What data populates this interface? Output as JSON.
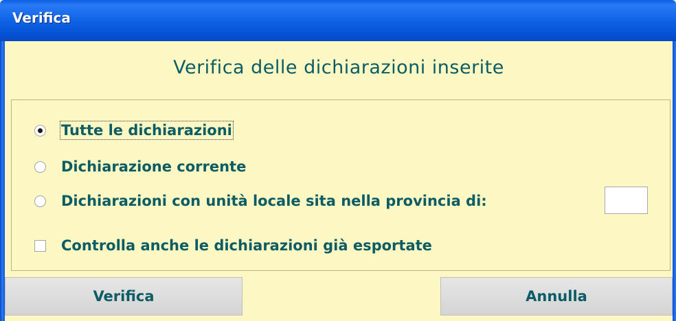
{
  "window": {
    "title": "Verifica"
  },
  "header": {
    "title": "Verifica delle dichiarazioni inserite"
  },
  "options": {
    "all": {
      "label": "Tutte le dichiarazioni",
      "selected": true
    },
    "current": {
      "label": "Dichiarazione corrente",
      "selected": false
    },
    "province": {
      "label": "Dichiarazioni con unità locale sita nella provincia di:",
      "selected": false,
      "value": ""
    }
  },
  "exported_check": {
    "label": "Controlla anche le dichiarazioni già esportate",
    "checked": false
  },
  "buttons": {
    "verify_label": "Verifica",
    "cancel_label": "Annulla"
  },
  "colors": {
    "title_bar": "#0a5ee0",
    "background": "#fdf7c3",
    "text": "#0b5c64"
  }
}
